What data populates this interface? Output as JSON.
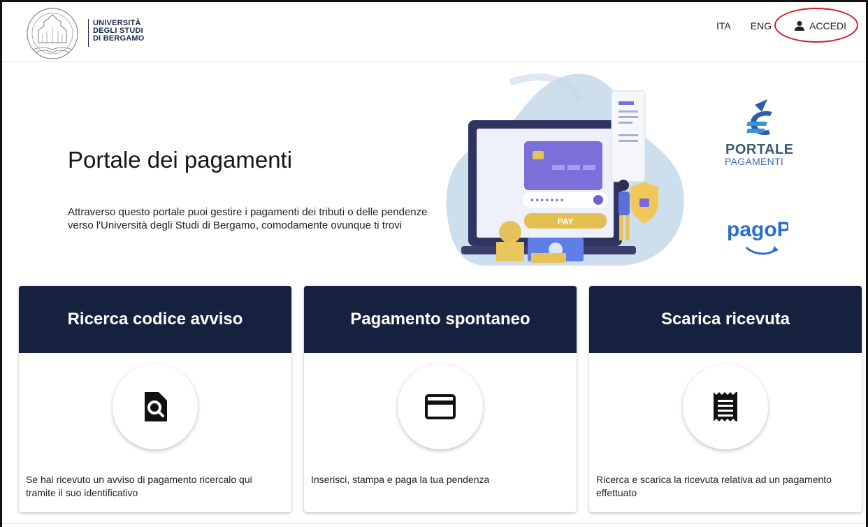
{
  "header": {
    "logo_lines": [
      "UNIVERSITÀ",
      "DEGLI STUDI",
      "DI BERGAMO"
    ],
    "seal_icon": "university-seal",
    "nav": {
      "ita": "ITA",
      "eng": "ENG",
      "login_label": "ACCEDI",
      "login_icon": "user-icon"
    }
  },
  "hero": {
    "title": "Portale dei pagamenti",
    "description": "Attraverso questo portale puoi gestire i pagamenti dei tributi o delle pendenze verso l'Università degli Studi di Bergamo, comodamente ovunque ti trovi",
    "illustration": {
      "pay_label": "PAY",
      "password_mask": "•••••••"
    },
    "brand_logos": {
      "portale_line1": "PORTALE",
      "portale_line2": "PAGAMENTI",
      "pagopa": "pagoPA"
    }
  },
  "cards": [
    {
      "title": "Ricerca codice avviso",
      "icon": "document-search-icon",
      "text": "Se hai ricevuto un avviso di pagamento ricercalo qui tramite il suo identificativo"
    },
    {
      "title": "Pagamento spontaneo",
      "icon": "credit-card-icon",
      "text": "Inserisci, stampa e paga la tua pendenza"
    },
    {
      "title": "Scarica ricevuta",
      "icon": "receipt-icon",
      "text": "Ricerca e scarica la ricevuta relativa ad un pagamento effettuato"
    }
  ],
  "colors": {
    "card_header": "#16213f",
    "highlight": "#d41e2a",
    "brand_navy": "#1b2a4a"
  }
}
